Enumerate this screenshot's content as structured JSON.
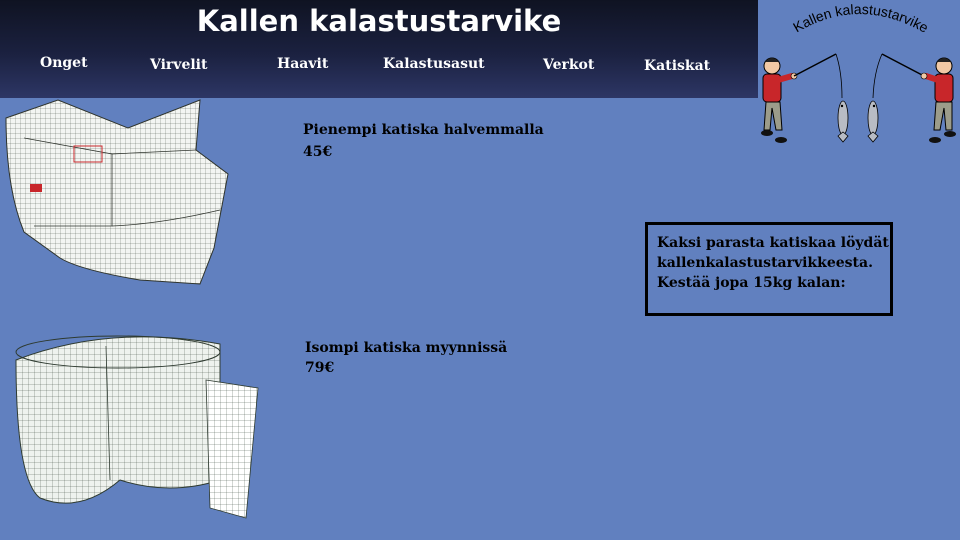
{
  "header": {
    "title": "Kallen kalastustarvike",
    "nav": [
      "Onget",
      "Virvelit",
      "Haavit",
      "Kalastusasut",
      "Verkot",
      "Katiskat"
    ]
  },
  "logo": {
    "text": "Kallen kalastustarvike"
  },
  "products": [
    {
      "title": "Pienempi katiska halvemmalla",
      "price": "45€"
    },
    {
      "title": "Isompi katiska myynnissä",
      "price": "79€"
    }
  ],
  "info": {
    "lines": [
      "Kaksi parasta katiskaa löydät",
      "kallenkalastustarvikkeesta.",
      "Kestää jopa 15kg kalan:"
    ]
  },
  "colors": {
    "background": "#6180bf",
    "header": "#1b2140",
    "text": "#000000"
  }
}
